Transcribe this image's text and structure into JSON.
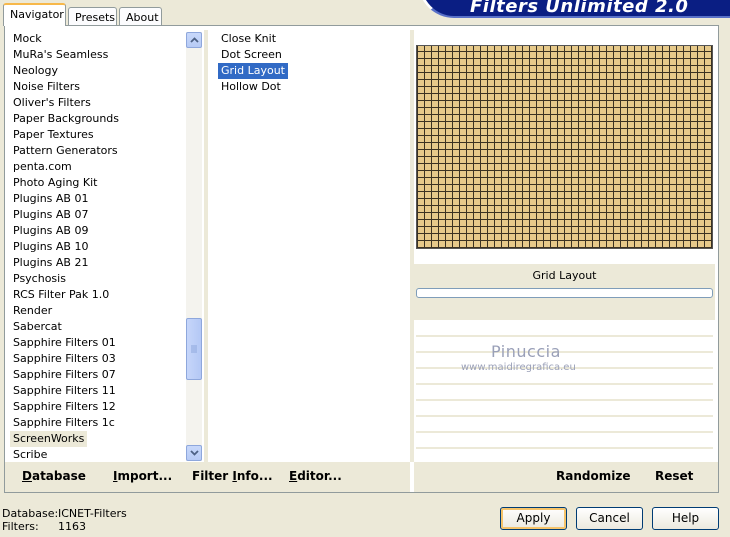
{
  "tabs": [
    "Navigator",
    "Presets",
    "About"
  ],
  "brand": "Filters Unlimited 2.0",
  "categories": [
    "Mock",
    "MuRa's Seamless",
    "Neology",
    "Noise Filters",
    "Oliver's Filters",
    "Paper Backgrounds",
    "Paper Textures",
    "Pattern Generators",
    "penta.com",
    "Photo Aging Kit",
    "Plugins AB 01",
    "Plugins AB 07",
    "Plugins AB 09",
    "Plugins AB 10",
    "Plugins AB 21",
    "Psychosis",
    "RCS Filter Pak 1.0",
    "Render",
    "Sabercat",
    "Sapphire Filters 01",
    "Sapphire Filters 03",
    "Sapphire Filters 07",
    "Sapphire Filters 11",
    "Sapphire Filters 12",
    "Sapphire Filters 1c",
    "ScreenWorks",
    "Scribe"
  ],
  "highlighted_category": "ScreenWorks",
  "filters": [
    "Close Knit",
    "Dot Screen",
    "Grid Layout",
    "Hollow Dot"
  ],
  "selected_filter": "Grid Layout",
  "filter_name": "Grid Layout",
  "bottom_left": {
    "database_pre": "",
    "database_u": "D",
    "database_post": "atabase",
    "import_pre": "",
    "import_u": "I",
    "import_post": "mport...",
    "filterinfo_pre": "Filter ",
    "filterinfo_u": "I",
    "filterinfo_post": "nfo...",
    "editor_pre": "",
    "editor_u": "E",
    "editor_post": "ditor..."
  },
  "randomize_label": "Randomize",
  "reset_label": "Reset",
  "watermark": {
    "line1": "Pinuccia",
    "line2": "www.maidiregrafica.eu"
  },
  "status": {
    "database_label": "Database:",
    "database_value": "ICNET-Filters",
    "filters_label": "Filters:",
    "filters_value": "1163"
  },
  "buttons": {
    "apply": "Apply",
    "cancel": "Cancel",
    "help": "Help"
  },
  "colors": {
    "selection": "#316ac5",
    "preview_fill": "#e6c98a",
    "brand_bg": "#0a1e83"
  }
}
